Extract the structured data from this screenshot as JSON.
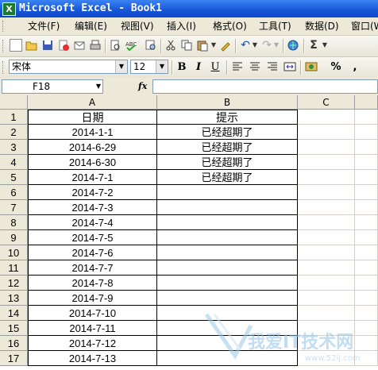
{
  "window": {
    "title": "Microsoft Excel - Book1",
    "app_icon": "excel-icon"
  },
  "menu": [
    {
      "label": "文件(F)"
    },
    {
      "label": "编辑(E)"
    },
    {
      "label": "视图(V)"
    },
    {
      "label": "插入(I)"
    },
    {
      "label": "格式(O)"
    },
    {
      "label": "工具(T)"
    },
    {
      "label": "数据(D)"
    },
    {
      "label": "窗口(W)"
    }
  ],
  "format_toolbar": {
    "font_name": "宋体",
    "font_size": "12",
    "bold": "B",
    "italic": "I",
    "underline": "U",
    "percent": "%",
    "comma": ","
  },
  "formula_bar": {
    "name_box": "F18",
    "fx": "fx",
    "formula": ""
  },
  "columns": [
    "A",
    "B",
    "C"
  ],
  "rows": [
    {
      "num": "1",
      "a": "日期",
      "b": "提示"
    },
    {
      "num": "2",
      "a": "2014-1-1",
      "b": "已经超期了"
    },
    {
      "num": "3",
      "a": "2014-6-29",
      "b": "已经超期了"
    },
    {
      "num": "4",
      "a": "2014-6-30",
      "b": "已经超期了"
    },
    {
      "num": "5",
      "a": "2014-7-1",
      "b": "已经超期了"
    },
    {
      "num": "6",
      "a": "2014-7-2",
      "b": ""
    },
    {
      "num": "7",
      "a": "2014-7-3",
      "b": ""
    },
    {
      "num": "8",
      "a": "2014-7-4",
      "b": ""
    },
    {
      "num": "9",
      "a": "2014-7-5",
      "b": ""
    },
    {
      "num": "10",
      "a": "2014-7-6",
      "b": ""
    },
    {
      "num": "11",
      "a": "2014-7-7",
      "b": ""
    },
    {
      "num": "12",
      "a": "2014-7-8",
      "b": ""
    },
    {
      "num": "13",
      "a": "2014-7-9",
      "b": ""
    },
    {
      "num": "14",
      "a": "2014-7-10",
      "b": ""
    },
    {
      "num": "15",
      "a": "2014-7-11",
      "b": ""
    },
    {
      "num": "16",
      "a": "2014-7-12",
      "b": ""
    },
    {
      "num": "17",
      "a": "2014-7-13",
      "b": ""
    }
  ],
  "watermark": {
    "text": "我爱IT技术网",
    "url": "www.52ij.com"
  }
}
